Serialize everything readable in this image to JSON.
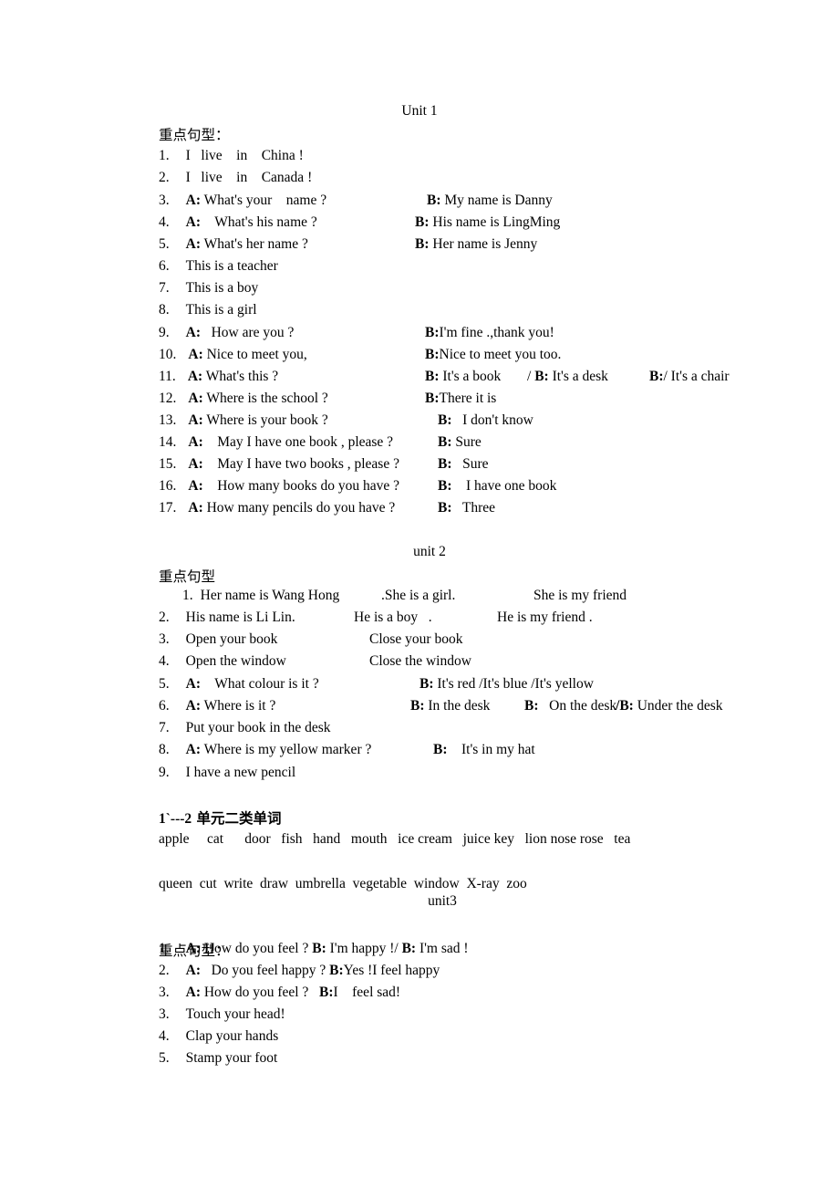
{
  "document": {
    "sections": [
      {
        "id": "unit1",
        "title": "Unit 1",
        "subheading": "重点句型：",
        "items": [
          {
            "num": "1.",
            "a_label": "",
            "a_text": "I   live    in    China !",
            "b_label": "",
            "b_text": "",
            "extra_label": "",
            "extra_text": "",
            "extra2_label": "",
            "extra2_text": ""
          },
          {
            "num": "2.",
            "a_label": "",
            "a_text": "I   live    in    Canada !",
            "b_label": "",
            "b_text": "",
            "extra_label": "",
            "extra_text": "",
            "extra2_label": "",
            "extra2_text": ""
          },
          {
            "num": "3.",
            "a_label": "A:",
            "a_text": " What's your    name ?",
            "b_label": "B:",
            "b_text": " My name is Danny",
            "extra_label": "",
            "extra_text": "",
            "extra2_label": "",
            "extra2_text": ""
          },
          {
            "num": "4.",
            "a_label": "A:",
            "a_text": "    What's his name ?",
            "b_label": "B:",
            "b_text": " His name is LingMing",
            "extra_label": "",
            "extra_text": "",
            "extra2_label": "",
            "extra2_text": ""
          },
          {
            "num": "5.",
            "a_label": "A:",
            "a_text": " What's her name ?",
            "b_label": "B:",
            "b_text": " Her name is Jenny",
            "extra_label": "",
            "extra_text": "",
            "extra2_label": "",
            "extra2_text": ""
          },
          {
            "num": "6.",
            "a_label": "",
            "a_text": "This is a teacher",
            "b_label": "",
            "b_text": "",
            "extra_label": "",
            "extra_text": "",
            "extra2_label": "",
            "extra2_text": ""
          },
          {
            "num": "7.",
            "a_label": "",
            "a_text": "This is a boy",
            "b_label": "",
            "b_text": "",
            "extra_label": "",
            "extra_text": "",
            "extra2_label": "",
            "extra2_text": ""
          },
          {
            "num": "8.",
            "a_label": "",
            "a_text": "This is a girl",
            "b_label": "",
            "b_text": "",
            "extra_label": "",
            "extra_text": "",
            "extra2_label": "",
            "extra2_text": ""
          },
          {
            "num": "9.",
            "a_label": "A:",
            "a_text": "   How are you ?",
            "b_label": "B:",
            "b_text": "I'm fine .,thank you!",
            "extra_label": "",
            "extra_text": "",
            "extra2_label": "",
            "extra2_text": ""
          },
          {
            "num": "10.",
            "a_label": "A:",
            "a_text": " Nice to meet you,",
            "b_label": "B:",
            "b_text": "Nice to meet you too.",
            "extra_label": "",
            "extra_text": "",
            "extra2_label": "",
            "extra2_text": ""
          },
          {
            "num": "11.",
            "a_label": "A:",
            "a_text": " What's this ?",
            "b_label": "B:",
            "b_text": " It's a book",
            "extra_label": "B:",
            "extra_prefix": "/ ",
            "extra_text": " It's a desk",
            "extra2_label": "B:",
            "extra2_text": "/ It's a chair"
          },
          {
            "num": "12.",
            "a_label": "A:",
            "a_text": " Where is the school ?",
            "b_label": "B:",
            "b_text": "There it is",
            "extra_label": "",
            "extra_text": "",
            "extra2_label": "",
            "extra2_text": ""
          },
          {
            "num": "13.",
            "a_label": "A:",
            "a_text": " Where is your book ?",
            "b_label": "B:",
            "b_text": "   I don't know",
            "extra_label": "",
            "extra_text": "",
            "extra2_label": "",
            "extra2_text": ""
          },
          {
            "num": "14.",
            "a_label": "A:",
            "a_text": "    May I have one book , please ?",
            "b_label": "B:",
            "b_text": " Sure",
            "extra_label": "",
            "extra_text": "",
            "extra2_label": "",
            "extra2_text": ""
          },
          {
            "num": "15.",
            "a_label": "A:",
            "a_text": "    May I have two books , please ?",
            "b_label": "B:",
            "b_text": "   Sure",
            "extra_label": "",
            "extra_text": "",
            "extra2_label": "",
            "extra2_text": ""
          },
          {
            "num": "16.",
            "a_label": "A:",
            "a_text": "    How many books do you have ?",
            "b_label": "B:",
            "b_text": "    I have one book",
            "extra_label": "",
            "extra_text": "",
            "extra2_label": "",
            "extra2_text": ""
          },
          {
            "num": "17.",
            "a_label": "A:",
            "a_text": " How many pencils do you have ?",
            "b_label": "B:",
            "b_text": "   Three",
            "extra_label": "",
            "extra_text": "",
            "extra2_label": "",
            "extra2_text": ""
          }
        ]
      },
      {
        "id": "unit2",
        "title": "unit 2",
        "subheading": "重点句型",
        "items": [
          {
            "num": "1.",
            "a_label": "",
            "a_text": "Her name is Wang Hong",
            "b_label": "",
            "b_text": ".She is a girl.",
            "extra_label": "",
            "extra_text": "She is my friend",
            "extra2_label": "",
            "extra2_text": ""
          },
          {
            "num": "2.",
            "a_label": "",
            "a_text": "His name is Li Lin.",
            "b_label": "",
            "b_text": "He is a boy   .",
            "extra_label": "",
            "extra_text": "He is my friend .",
            "extra2_label": "",
            "extra2_text": ""
          },
          {
            "num": "3.",
            "a_label": "",
            "a_text": "Open your book",
            "b_label": "",
            "b_text": "Close your book",
            "extra_label": "",
            "extra_text": "",
            "extra2_label": "",
            "extra2_text": ""
          },
          {
            "num": "4.",
            "a_label": "",
            "a_text": "Open the window",
            "b_label": "",
            "b_text": "Close the window",
            "extra_label": "",
            "extra_text": "",
            "extra2_label": "",
            "extra2_text": ""
          },
          {
            "num": "5.",
            "a_label": "A:",
            "a_text": "    What colour is it ?",
            "b_label": "B:",
            "b_text": " It's red /It's blue /It's yellow",
            "extra_label": "",
            "extra_text": "",
            "extra2_label": "",
            "extra2_text": ""
          },
          {
            "num": "6.",
            "a_label": "A:",
            "a_text": " Where is it ?",
            "b_label": "B:",
            "b_text": " In the desk",
            "extra_label": "B:",
            "extra_prefix": "",
            "extra_text": "   On the desk",
            "extra2_label": "B:",
            "extra2_prefix": "/",
            "extra2_text": " Under the desk"
          },
          {
            "num": "7.",
            "a_label": "",
            "a_text": "Put your book in the desk",
            "b_label": "",
            "b_text": "",
            "extra_label": "",
            "extra_text": "",
            "extra2_label": "",
            "extra2_text": ""
          },
          {
            "num": "8.",
            "a_label": "A:",
            "a_text": " Where is my yellow marker ?",
            "b_label": "B:",
            "b_text": "    It's in my hat",
            "extra_label": "",
            "extra_text": "",
            "extra2_label": "",
            "extra2_text": ""
          },
          {
            "num": "9.",
            "a_label": "",
            "a_text": "I have a new pencil",
            "b_label": "",
            "b_text": "",
            "extra_label": "",
            "extra_text": "",
            "extra2_label": "",
            "extra2_text": ""
          }
        ]
      },
      {
        "id": "unit3",
        "title": "unit3",
        "subheading": "重点句型：",
        "items": [
          {
            "num": "1.",
            "a_label": "A:",
            "a_text": " How do you feel ? ",
            "b_label": "B:",
            "b_text": " I'm happy !/ ",
            "extra_label": "B:",
            "extra_text": " I'm sad !",
            "extra2_label": "",
            "extra2_text": ""
          },
          {
            "num": "2.",
            "a_label": "A:",
            "a_text": "   Do you feel happy ? ",
            "b_label": "B:",
            "b_text": "Yes !I feel happy",
            "extra_label": "",
            "extra_text": "",
            "extra2_label": "",
            "extra2_text": ""
          },
          {
            "num": "3.",
            "a_label": "A:",
            "a_text": " How do you feel ?   ",
            "b_label": "B:",
            "b_text": "I    feel sad!",
            "extra_label": "",
            "extra_text": "",
            "extra2_label": "",
            "extra2_text": ""
          },
          {
            "num": "3.",
            "a_label": "",
            "a_text": "Touch your head!",
            "b_label": "",
            "b_text": "",
            "extra_label": "",
            "extra_text": "",
            "extra2_label": "",
            "extra2_text": ""
          },
          {
            "num": "4.",
            "a_label": "",
            "a_text": "Clap your hands",
            "b_label": "",
            "b_text": "",
            "extra_label": "",
            "extra_text": "",
            "extra2_label": "",
            "extra2_text": ""
          },
          {
            "num": "5.",
            "a_label": "",
            "a_text": "Stamp your foot",
            "b_label": "",
            "b_text": "",
            "extra_label": "",
            "extra_text": "",
            "extra2_label": "",
            "extra2_text": ""
          }
        ]
      }
    ],
    "vocabulary": {
      "heading_prefix": "1`---2",
      "heading_cn": " 单元二类单词",
      "row1": "apple     cat      door   fish   hand   mouth   ice cream   juice key   lion nose rose   tea",
      "row2": "queen  cut  write  draw  umbrella  vegetable  window  X-ray  zoo"
    }
  }
}
